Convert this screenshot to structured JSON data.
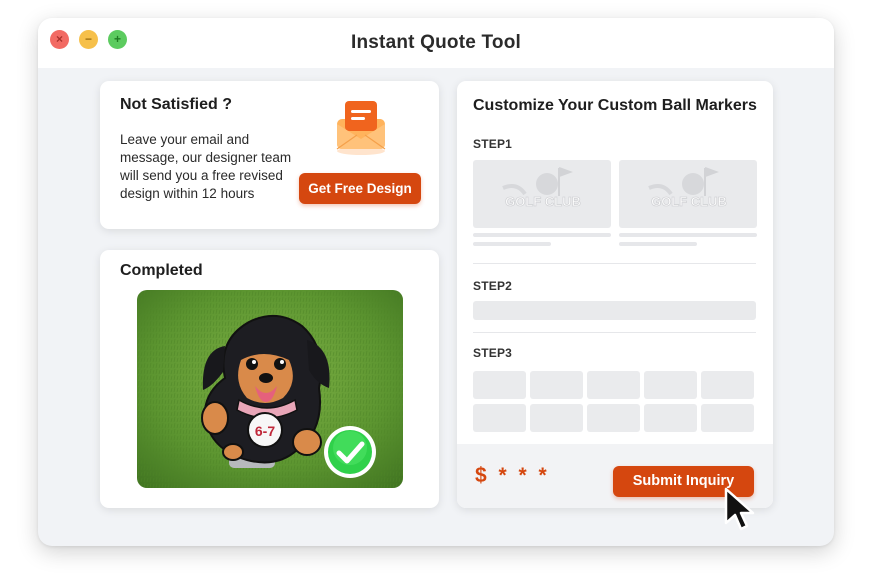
{
  "window": {
    "title": "Instant Quote Tool",
    "controls": {
      "close": "×",
      "minimize": "−",
      "maximize": "+"
    }
  },
  "not_satisfied": {
    "title": "Not Satisfied ?",
    "body": "Leave your email and message, our designer team will send you a free revised design within 12 hours",
    "button": "Get Free Design",
    "icon": "mail-envelope-icon"
  },
  "completed": {
    "title": "Completed",
    "image": "enamel-dog-ball-marker-photo",
    "marker_text": "6-7",
    "badge": "check-icon"
  },
  "customize": {
    "title": "Customize Your Custom Ball Markers",
    "steps": [
      {
        "label": "STEP1"
      },
      {
        "label": "STEP2"
      },
      {
        "label": "STEP3"
      }
    ],
    "thumbnail_text": "GOLF CLUB",
    "price": "$ * * *",
    "submit_button": "Submit Inquiry"
  },
  "colors": {
    "accent": "#d5470f",
    "window_bg": "#f1f3f6",
    "card_bg": "#ffffff",
    "placeholder": "#e9eaec",
    "success": "#2fd14a"
  }
}
